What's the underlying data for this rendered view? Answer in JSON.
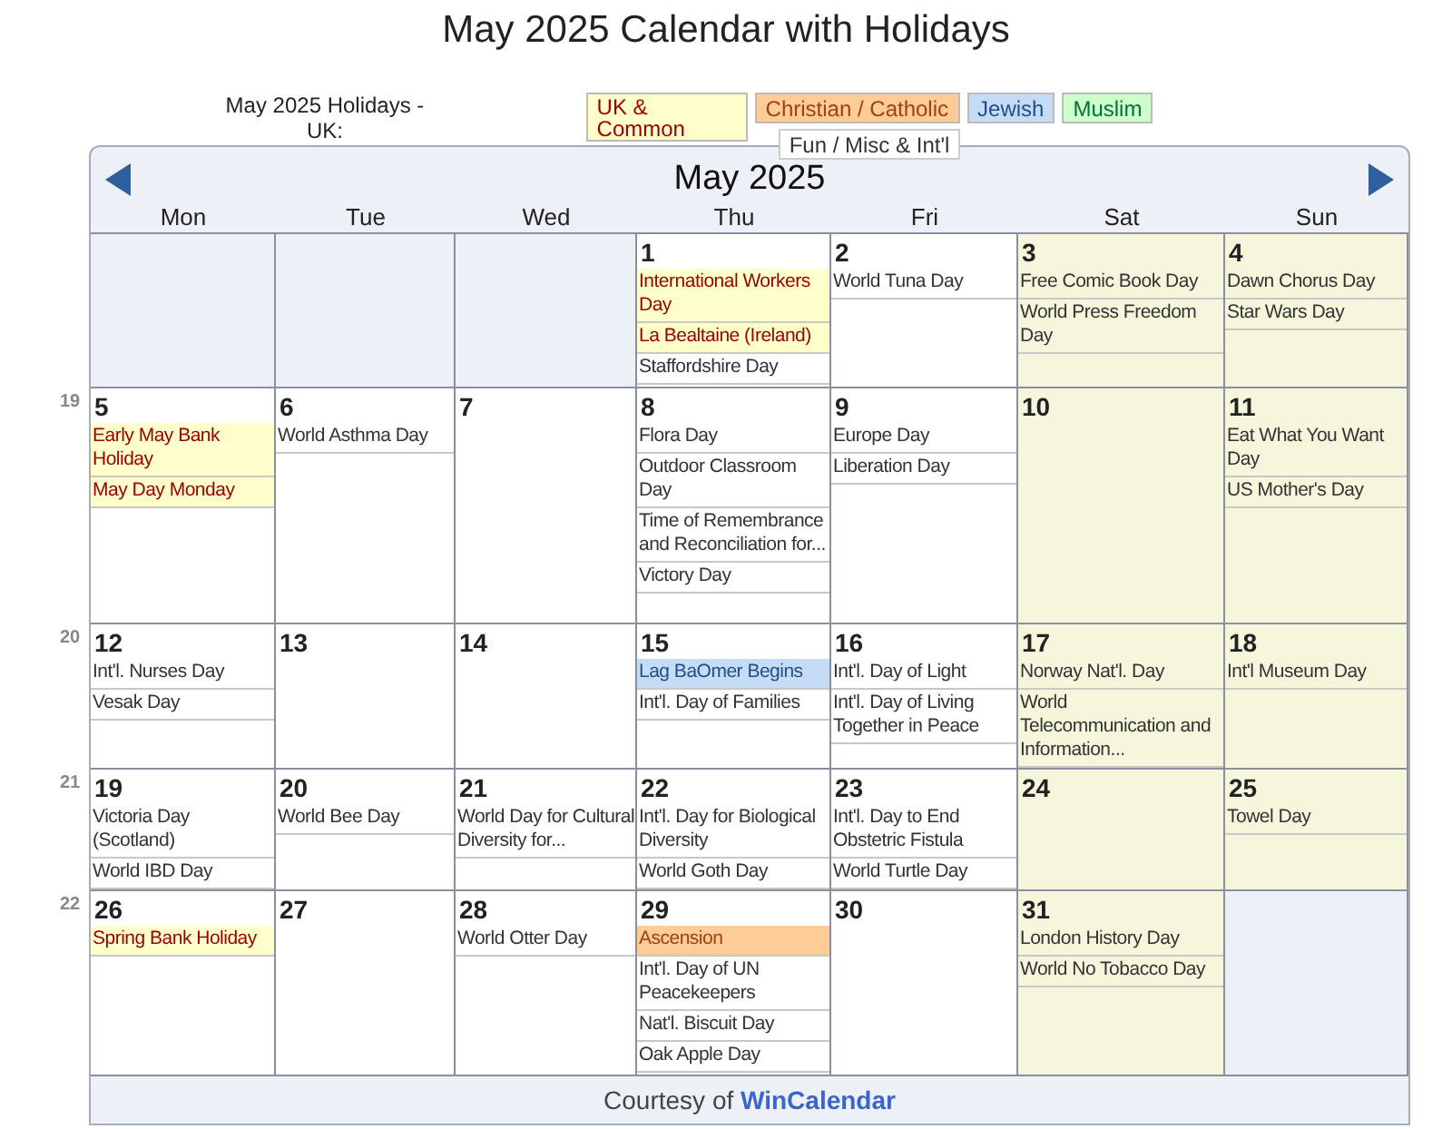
{
  "page_title": "May 2025 Calendar with Holidays",
  "legend": {
    "label": "May 2025 Holidays - UK:",
    "items": [
      {
        "label": "UK & Common",
        "kind": "uk"
      },
      {
        "label": "Christian / Catholic",
        "kind": "christian"
      },
      {
        "label": "Jewish",
        "kind": "jewish"
      },
      {
        "label": "Muslim",
        "kind": "muslim"
      },
      {
        "label": "Fun / Misc & Int'l",
        "kind": "fun"
      }
    ]
  },
  "calendar": {
    "month_title": "May 2025",
    "weekdays": [
      {
        "label": "Mon",
        "weekend": false
      },
      {
        "label": "Tue",
        "weekend": false
      },
      {
        "label": "Wed",
        "weekend": false
      },
      {
        "label": "Thu",
        "weekend": false
      },
      {
        "label": "Fri",
        "weekend": false
      },
      {
        "label": "Sat",
        "weekend": true
      },
      {
        "label": "Sun",
        "weekend": true
      }
    ],
    "weeks": [
      {
        "days": [
          {
            "kind": "blank"
          },
          {
            "kind": "blank"
          },
          {
            "kind": "blank"
          },
          {
            "kind": "day",
            "day": "1",
            "events": [
              {
                "name": "International Workers Day",
                "kind": "uk"
              },
              {
                "name": "La Bealtaine (Ireland)",
                "kind": "uk"
              },
              {
                "name": "Staffordshire Day",
                "kind": "fun"
              }
            ]
          },
          {
            "kind": "day",
            "day": "2",
            "events": [
              {
                "name": "World Tuna Day",
                "kind": "fun"
              }
            ]
          },
          {
            "kind": "day",
            "day": "3",
            "events": [
              {
                "name": "Free Comic Book Day",
                "kind": "fun"
              },
              {
                "name": "World Press Freedom Day",
                "kind": "fun"
              }
            ]
          },
          {
            "kind": "day",
            "day": "4",
            "events": [
              {
                "name": "Dawn Chorus Day",
                "kind": "fun"
              },
              {
                "name": "Star Wars Day",
                "kind": "fun"
              }
            ]
          }
        ]
      },
      {
        "week_number": "19",
        "days": [
          {
            "kind": "day",
            "day": "5",
            "events": [
              {
                "name": "Early May Bank Holiday",
                "kind": "uk"
              },
              {
                "name": "May Day Monday",
                "kind": "uk"
              }
            ]
          },
          {
            "kind": "day",
            "day": "6",
            "events": [
              {
                "name": "World Asthma Day",
                "kind": "fun"
              }
            ]
          },
          {
            "kind": "day",
            "day": "7"
          },
          {
            "kind": "day",
            "day": "8",
            "events": [
              {
                "name": "Flora Day",
                "kind": "fun"
              },
              {
                "name": "Outdoor Classroom Day",
                "kind": "fun"
              },
              {
                "name": "Time of Remembrance and Reconciliation for...",
                "kind": "fun"
              },
              {
                "name": "Victory Day",
                "kind": "fun"
              }
            ]
          },
          {
            "kind": "day",
            "day": "9",
            "events": [
              {
                "name": "Europe Day",
                "kind": "fun"
              },
              {
                "name": "Liberation Day",
                "kind": "fun"
              }
            ]
          },
          {
            "kind": "day",
            "day": "10"
          },
          {
            "kind": "day",
            "day": "11",
            "events": [
              {
                "name": "Eat What You Want Day",
                "kind": "fun"
              },
              {
                "name": "US Mother's Day",
                "kind": "fun"
              }
            ]
          }
        ]
      },
      {
        "week_number": "20",
        "days": [
          {
            "kind": "day",
            "day": "12",
            "events": [
              {
                "name": "Int'l. Nurses Day",
                "kind": "fun"
              },
              {
                "name": "Vesak Day",
                "kind": "fun"
              }
            ]
          },
          {
            "kind": "day",
            "day": "13"
          },
          {
            "kind": "day",
            "day": "14"
          },
          {
            "kind": "day",
            "day": "15",
            "events": [
              {
                "name": "Lag BaOmer Begins",
                "kind": "jewish"
              },
              {
                "name": "Int'l. Day of Families",
                "kind": "fun"
              }
            ]
          },
          {
            "kind": "day",
            "day": "16",
            "events": [
              {
                "name": "Int'l. Day of Light",
                "kind": "fun"
              },
              {
                "name": "Int'l. Day of Living Together in Peace",
                "kind": "fun"
              }
            ]
          },
          {
            "kind": "day",
            "day": "17",
            "events": [
              {
                "name": "Norway Nat'l. Day",
                "kind": "fun"
              },
              {
                "name": "World Telecommunication and Information...",
                "kind": "fun"
              }
            ]
          },
          {
            "kind": "day",
            "day": "18",
            "events": [
              {
                "name": "Int'l Museum Day",
                "kind": "fun"
              }
            ]
          }
        ]
      },
      {
        "week_number": "21",
        "days": [
          {
            "kind": "day",
            "day": "19",
            "events": [
              {
                "name": "Victoria Day (Scotland)",
                "kind": "fun"
              },
              {
                "name": "World IBD Day",
                "kind": "fun"
              }
            ]
          },
          {
            "kind": "day",
            "day": "20",
            "events": [
              {
                "name": "World Bee Day",
                "kind": "fun"
              }
            ]
          },
          {
            "kind": "day",
            "day": "21",
            "events": [
              {
                "name": "World Day for Cultural Diversity for...",
                "kind": "fun"
              }
            ]
          },
          {
            "kind": "day",
            "day": "22",
            "events": [
              {
                "name": "Int'l. Day for Biological Diversity",
                "kind": "fun"
              },
              {
                "name": "World Goth Day",
                "kind": "fun"
              }
            ]
          },
          {
            "kind": "day",
            "day": "23",
            "events": [
              {
                "name": "Int'l. Day to End Obstetric Fistula",
                "kind": "fun"
              },
              {
                "name": "World Turtle Day",
                "kind": "fun"
              }
            ]
          },
          {
            "kind": "day",
            "day": "24"
          },
          {
            "kind": "day",
            "day": "25",
            "events": [
              {
                "name": "Towel Day",
                "kind": "fun"
              }
            ]
          }
        ]
      },
      {
        "week_number": "22",
        "days": [
          {
            "kind": "day",
            "day": "26",
            "events": [
              {
                "name": "Spring Bank Holiday",
                "kind": "uk"
              }
            ]
          },
          {
            "kind": "day",
            "day": "27"
          },
          {
            "kind": "day",
            "day": "28",
            "events": [
              {
                "name": "World Otter Day",
                "kind": "fun"
              }
            ]
          },
          {
            "kind": "day",
            "day": "29",
            "events": [
              {
                "name": "Ascension",
                "kind": "christian"
              },
              {
                "name": "Int'l. Day of UN Peacekeepers",
                "kind": "fun"
              },
              {
                "name": "Nat'l. Biscuit Day",
                "kind": "fun"
              },
              {
                "name": "Oak Apple Day",
                "kind": "fun"
              }
            ]
          },
          {
            "kind": "day",
            "day": "30"
          },
          {
            "kind": "day",
            "day": "31",
            "events": [
              {
                "name": "London History Day",
                "kind": "fun"
              },
              {
                "name": "World No Tobacco Day",
                "kind": "fun"
              }
            ]
          },
          {
            "kind": "blank"
          }
        ]
      }
    ]
  },
  "footer": {
    "text": "Courtesy of",
    "link": "WinCalendar"
  }
}
